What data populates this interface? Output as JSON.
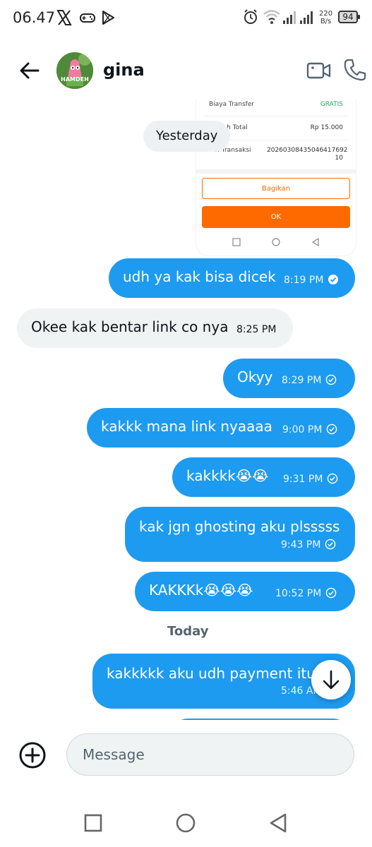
{
  "status_bar": {
    "time": "06.47",
    "net_speed_value": "220",
    "net_speed_unit": "B/s",
    "battery": "94",
    "icons": [
      "x-logo-icon",
      "gamepad-icon",
      "play-store-icon",
      "alarm-icon",
      "wifi-icon",
      "signal-icon",
      "signal-icon"
    ]
  },
  "header": {
    "contact_name": "gina",
    "avatar_label": "HAMDEH",
    "icons": [
      "back-arrow-icon",
      "video-call-icon",
      "phone-icon"
    ]
  },
  "receipt_image": {
    "rows": [
      {
        "label": "Biaya Transfer",
        "value": "GRATIS"
      },
      {
        "label": "Jumlah Total",
        "value": "Rp 15.000"
      },
      {
        "label": "No. Transaksi",
        "value": "20260308435046417692 10"
      }
    ],
    "share_button": "Bagikan",
    "ok_button": "OK"
  },
  "date_separators": {
    "yesterday": "Yesterday",
    "today": "Today"
  },
  "messages": [
    {
      "text": "udh ya kak bisa dicek",
      "time": "8:19 PM",
      "direction": "out",
      "status": "read"
    },
    {
      "text": "Okee kak bentar link co nya",
      "time": "8:25 PM",
      "direction": "in"
    },
    {
      "text": "Okyy",
      "time": "8:29 PM",
      "direction": "out",
      "status": "sent"
    },
    {
      "text": "kakkk mana link nyaaaa",
      "time": "9:00 PM",
      "direction": "out",
      "status": "sent"
    },
    {
      "text": "kakkkk😭😭",
      "time": "9:31 PM",
      "direction": "out",
      "status": "sent"
    },
    {
      "text": "kak jgn ghosting aku plsssss",
      "time": "9:43 PM",
      "direction": "out",
      "status": "sent"
    },
    {
      "text": "KAKKKk😭😭😭",
      "time": "10:52 PM",
      "direction": "out",
      "status": "sent"
    },
    {
      "text": "kakkkkk aku udh payment itu",
      "time": "5:46 AM",
      "direction": "out",
      "status": "sent"
    }
  ],
  "composer": {
    "placeholder": "Message"
  },
  "colors": {
    "outgoing_bubble": "#1d9bf0",
    "incoming_bubble": "#eff3f4",
    "receipt_accent": "#ff6a00"
  }
}
